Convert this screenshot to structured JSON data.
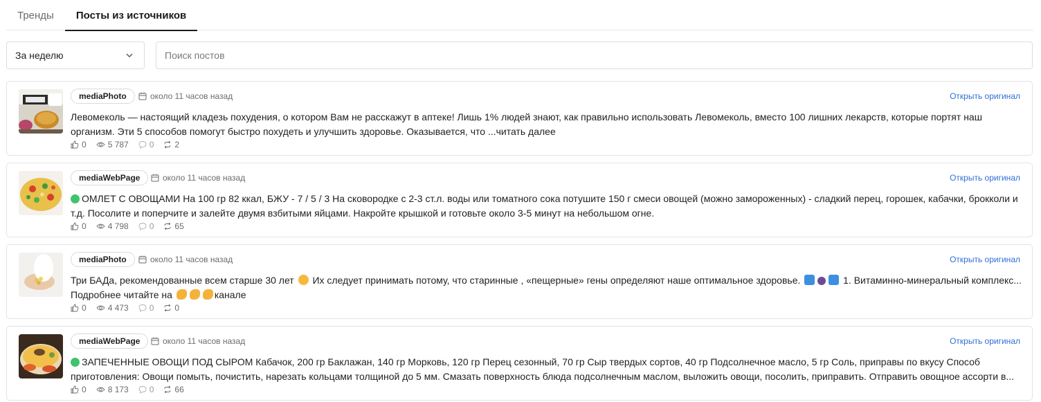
{
  "tabs": [
    {
      "label": "Тренды",
      "active": false
    },
    {
      "label": "Посты из источников",
      "active": true
    }
  ],
  "filters": {
    "period_value": "За неделю",
    "search_placeholder": "Поиск постов"
  },
  "posts": [
    {
      "source": "mediaPhoto",
      "time": "около 11 часов назад",
      "open_label": "Открыть оригинал",
      "text_line1": "Левомеколь — настоящий кладезь похудения, о котором Вам не расскажут в аптеке! Лишь 1% людей знают, как правильно использовать Левомеколь, вместо 100 лишних лекарств, которые портят наш",
      "text_line2": "организм. Эти 5 способов помогут быстро похудеть и улучшить здоровье. Оказывается, что ...читать далее",
      "likes": "0",
      "views": "5 787",
      "comments": "0",
      "reposts": "2"
    },
    {
      "source": "mediaWebPage",
      "time": "около 11 часов назад",
      "open_label": "Открыть оригинал",
      "text_line1": "ОМЛЕТ С ОВОЩАМИ На 100 гр 82 ккал, БЖУ - 7 / 5 / 3 На сковородке с 2-3 ст.л. воды или томатного сока потушите 150 г смеси овощей (можно замороженных) - сладкий перец, горошек, кабачки, брокколи и",
      "text_line2": "т.д. Посолите и поперчите и залейте двумя взбитыми яйцами. Накройте крышкой и готовьте около 3-5 минут на небольшом огне.",
      "likes": "0",
      "views": "4 798",
      "comments": "0",
      "reposts": "65"
    },
    {
      "source": "mediaPhoto",
      "time": "около 11 часов назад",
      "open_label": "Открыть оригинал",
      "text_line1a": "Три БАДа, рекомендованные всем старше 30 лет",
      "text_line1b": "Их следует принимать потому, что старинные , «пещерные» гены определяют наше оптимальное здоровье.",
      "text_line1c": "1. Витаминно-минеральный комплекс...",
      "text_line2": "Подробнее читайте на",
      "text_line2b": "канале",
      "likes": "0",
      "views": "4 473",
      "comments": "0",
      "reposts": "0"
    },
    {
      "source": "mediaWebPage",
      "time": "около 11 часов назад",
      "open_label": "Открыть оригинал",
      "text_line1": "ЗАПЕЧЕННЫЕ ОВОЩИ ПОД СЫРОМ Кабачок, 200 гр Баклажан, 140 гр Морковь, 120 гр Перец сезонный, 70 гр Сыр твердых сортов, 40 гр Подсолнечное масло, 5 гр Соль, приправы по вкусу Способ",
      "text_line2": "приготовления: Овощи помыть, почистить, нарезать кольцами толщиной до 5 мм. Смазать поверхность блюда подсолнечным маслом, выложить овощи, посолить, приправить. Отправить овощное ассорти в...",
      "likes": "0",
      "views": "8 173",
      "comments": "0",
      "reposts": "66"
    }
  ],
  "colors": {
    "link": "#2f6fd6",
    "border": "#e3e3e3",
    "muted_text": "#6b6b6b",
    "green_dot": "#3ec46d"
  }
}
